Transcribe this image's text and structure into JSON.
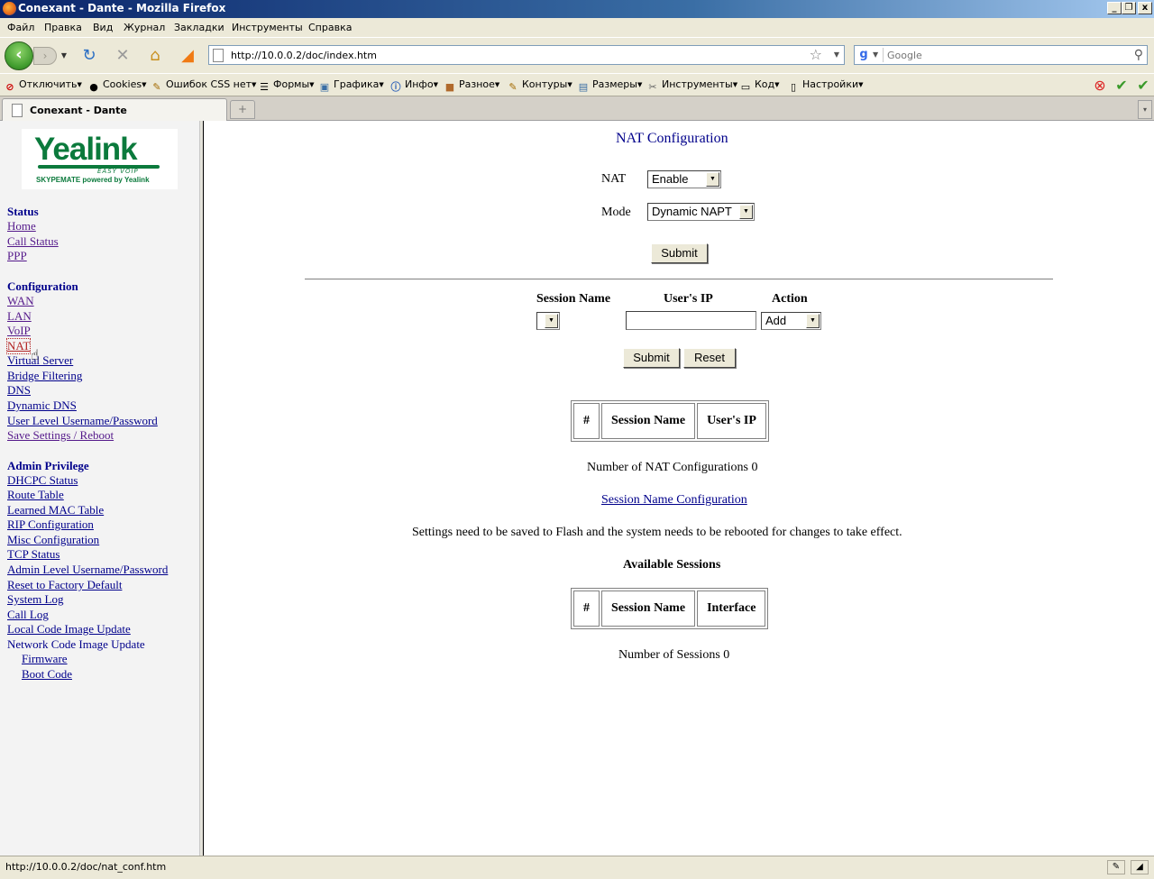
{
  "window": {
    "title": "Conexant - Dante - Mozilla Firefox",
    "controls": {
      "minimize": "_",
      "restore": "❐",
      "close": "x"
    }
  },
  "menu": [
    "Файл",
    "Правка",
    "Вид",
    "Журнал",
    "Закладки",
    "Инструменты",
    "Справка"
  ],
  "navbar": {
    "url": "http://10.0.0.2/doc/index.htm",
    "search_placeholder": "Google"
  },
  "devbar": {
    "items": [
      {
        "label": "Отключить",
        "icon": "disable-icon"
      },
      {
        "label": "Cookies",
        "icon": "cookies-icon"
      },
      {
        "label": "Ошибок CSS нет",
        "icon": "css-icon"
      },
      {
        "label": "Формы",
        "icon": "forms-icon"
      },
      {
        "label": "Графика",
        "icon": "images-icon"
      },
      {
        "label": "Инфо",
        "icon": "info-icon"
      },
      {
        "label": "Разное",
        "icon": "misc-icon"
      },
      {
        "label": "Контуры",
        "icon": "outline-icon"
      },
      {
        "label": "Размеры",
        "icon": "resize-icon"
      },
      {
        "label": "Инструменты",
        "icon": "tools-icon"
      },
      {
        "label": "Код",
        "icon": "source-icon"
      },
      {
        "label": "Настройки",
        "icon": "options-icon"
      }
    ]
  },
  "tab": {
    "label": "Conexant - Dante"
  },
  "sidebar": {
    "status": {
      "heading": "Status",
      "links": [
        "Home",
        "Call Status",
        "PPP"
      ]
    },
    "configuration": {
      "heading": "Configuration",
      "links": [
        "WAN",
        "LAN",
        "VoIP",
        "NAT",
        "Virtual Server",
        "Bridge Filtering",
        "DNS",
        "Dynamic DNS",
        "User Level Username/Password",
        "Save Settings / Reboot"
      ]
    },
    "admin": {
      "heading": "Admin Privilege",
      "links": [
        "DHCPC Status",
        "Route Table",
        "Learned MAC Table",
        "RIP Configuration",
        "Misc Configuration",
        "TCP Status",
        "Admin Level Username/Password",
        "Reset to Factory Default",
        "System Log",
        "Call Log",
        "Local Code Image Update"
      ],
      "network_update": "Network Code Image Update",
      "sub_links": [
        "Firmware",
        "Boot Code"
      ]
    }
  },
  "logo": {
    "name": "Yealink",
    "tagline": "EASY VOIP",
    "subtitle": "SKYPEMATE powered by Yealink"
  },
  "main": {
    "title": "NAT Configuration",
    "nat_label": "NAT",
    "nat_value": "Enable",
    "mode_label": "Mode",
    "mode_value": "Dynamic NAPT",
    "submit1": "Submit",
    "session_name_header": "Session Name",
    "users_ip_header": "User's IP",
    "action_header": "Action",
    "session_select_value": "",
    "ip_value": "",
    "action_value": "Add",
    "submit2": "Submit",
    "reset": "Reset",
    "table1_headers": [
      "#",
      "Session Name",
      "User's IP"
    ],
    "nat_count_text": "Number of NAT Configurations 0",
    "session_link": "Session Name Configuration",
    "note": "Settings need to be saved to Flash and the system needs to be rebooted for changes to take effect.",
    "available_title": "Available Sessions",
    "table2_headers": [
      "#",
      "Session Name",
      "Interface"
    ],
    "sessions_count_text": "Number of Sessions 0"
  },
  "statusbar": {
    "text": "http://10.0.0.2/doc/nat_conf.htm"
  }
}
